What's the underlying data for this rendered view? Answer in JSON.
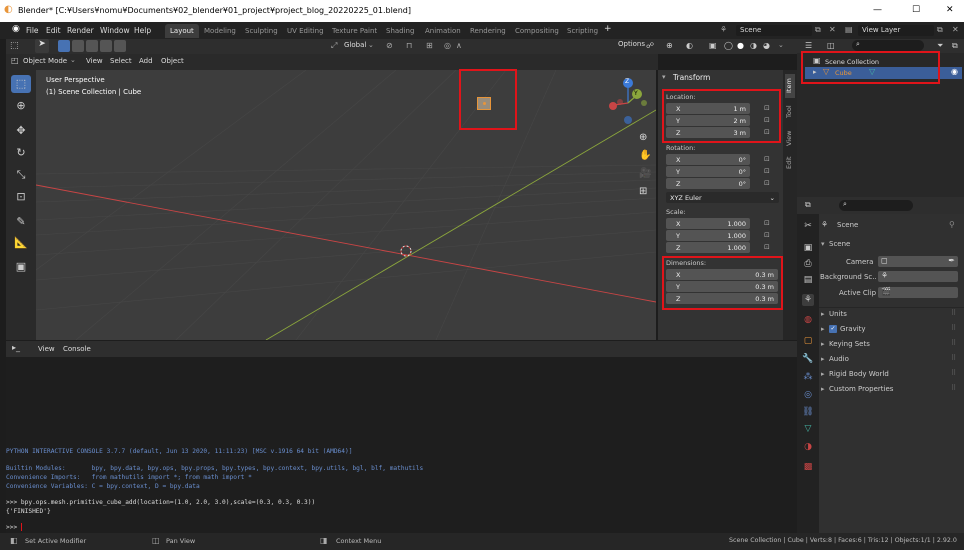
{
  "window": {
    "title": "Blender* [C:¥Users¥nomu¥Documents¥02_blender¥01_project¥project_blog_20220225_01.blend]",
    "minimize": "—",
    "maximize": "☐",
    "close": "✕"
  },
  "menu": {
    "file": "File",
    "edit": "Edit",
    "render": "Render",
    "window": "Window",
    "help": "Help"
  },
  "workspaces": [
    "Layout",
    "Modeling",
    "Sculpting",
    "UV Editing",
    "Texture Paint",
    "Shading",
    "Animation",
    "Rendering",
    "Compositing",
    "Scripting"
  ],
  "workspace_add": "+",
  "scene": {
    "name": "Scene",
    "view_layer": "View Layer"
  },
  "viewport": {
    "orientation": "Global",
    "mode": "Object Mode",
    "view_menu": "View",
    "select_menu": "Select",
    "add_menu": "Add",
    "object_menu": "Object",
    "options": "Options",
    "perspective": "User Perspective",
    "collection_info": "(1) Scene Collection | Cube",
    "gizmo": {
      "z": "Z",
      "y": "Y"
    }
  },
  "npanel": {
    "title": "Transform",
    "location_label": "Location:",
    "location": [
      {
        "axis": "X",
        "value": "1 m"
      },
      {
        "axis": "Y",
        "value": "2 m"
      },
      {
        "axis": "Z",
        "value": "3 m"
      }
    ],
    "rotation_label": "Rotation:",
    "rotation": [
      {
        "axis": "X",
        "value": "0°"
      },
      {
        "axis": "Y",
        "value": "0°"
      },
      {
        "axis": "Z",
        "value": "0°"
      }
    ],
    "rotation_mode": "XYZ Euler",
    "scale_label": "Scale:",
    "scale": [
      {
        "axis": "X",
        "value": "1.000"
      },
      {
        "axis": "Y",
        "value": "1.000"
      },
      {
        "axis": "Z",
        "value": "1.000"
      }
    ],
    "dimensions_label": "Dimensions:",
    "dimensions": [
      {
        "axis": "X",
        "value": "0.3 m"
      },
      {
        "axis": "Y",
        "value": "0.3 m"
      },
      {
        "axis": "Z",
        "value": "0.3 m"
      }
    ],
    "tabs": [
      "Item",
      "Tool",
      "View",
      "Edit"
    ]
  },
  "console": {
    "view": "View",
    "console": "Console",
    "lines": [
      "PYTHON INTERACTIVE CONSOLE 3.7.7 (default, Jun 13 2020, 11:11:23) [MSC v.1916 64 bit (AMD64)]",
      "",
      "Builtin Modules:       bpy, bpy.data, bpy.ops, bpy.props, bpy.types, bpy.context, bpy.utils, bgl, blf, mathutils",
      "Convenience Imports:   from mathutils import *; from math import *",
      "Convenience Variables: C = bpy.context, D = bpy.data",
      "",
      ">>> bpy.ops.mesh.primitive_cube_add(location=(1.0, 2.0, 3.0),scale=(0.3, 0.3, 0.3))",
      "{'FINISHED'}",
      "",
      ">>> "
    ]
  },
  "outliner": {
    "scene_collection": "Scene Collection",
    "cube": "Cube"
  },
  "properties": {
    "scene_title": "Scene",
    "scene_panel": "Scene",
    "camera": "Camera",
    "background_scene": "Background Sc..",
    "active_clip": "Active Clip",
    "sections": [
      "Units",
      "Gravity",
      "Keying Sets",
      "Audio",
      "Rigid Body World",
      "Custom Properties"
    ]
  },
  "status": {
    "left": "Set Active Modifier",
    "middle": "Pan View",
    "right": "Context Menu",
    "info": "Scene Collection | Cube | Verts:8 | Faces:6 | Tris:12 | Objects:1/1 | 2.92.0"
  },
  "colors": {
    "highlight_box": "#e0141a",
    "selection": "#3b5e99",
    "x_axis": "#c94545",
    "y_axis": "#8ba63c",
    "z_axis": "#3b7ad9",
    "object_orange": "#e8953a"
  }
}
